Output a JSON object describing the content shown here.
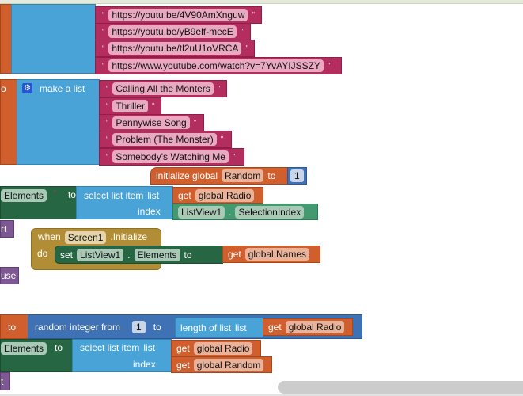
{
  "radio_urls": [
    "https://youtu.be/4V90AmXnguw",
    "https://youtu.be/yB9elf-mecE",
    "https://youtu.be/tl2uU1oVRCA",
    "https://www.youtube.com/watch?v=7YvAYIJSSZY"
  ],
  "names_block": {
    "to": "o",
    "make_list": "make a list",
    "items": [
      "Calling All the Monters",
      "Thriller",
      "Pennywise Song",
      "Problem (The Monster)",
      "Somebody's Watching Me"
    ]
  },
  "init_random": {
    "label": "initialize global",
    "var": "Random",
    "to": "to",
    "value": "1"
  },
  "set1": {
    "prop": "Elements",
    "to": "to",
    "select": "select list item",
    "list": "list",
    "get": "get",
    "var": "global Radio",
    "index": "index",
    "component": "ListView1",
    "dot": ".",
    "component_prop": "SelectionIndex"
  },
  "purple1": "rt",
  "event": {
    "when": "when",
    "component": "Screen1",
    "event": ".Initialize",
    "do": "do",
    "set": "set",
    "set_component": "ListView1",
    "dot": ".",
    "prop": "Elements",
    "to": "to",
    "get": "get",
    "var": "global Names"
  },
  "purple2": "use",
  "random_row": {
    "to": "to",
    "random": "random integer from",
    "from": "1",
    "to2": "to",
    "length": "length of list",
    "list": "list",
    "get": "get",
    "var": "global Radio"
  },
  "set2": {
    "prop": "Elements",
    "to": "to",
    "select": "select list item",
    "list": "list",
    "get": "get",
    "var1": "global Radio",
    "index": "index",
    "var2": "global Random"
  },
  "purple3": "t",
  "quote": "“",
  "quote_close": "\""
}
